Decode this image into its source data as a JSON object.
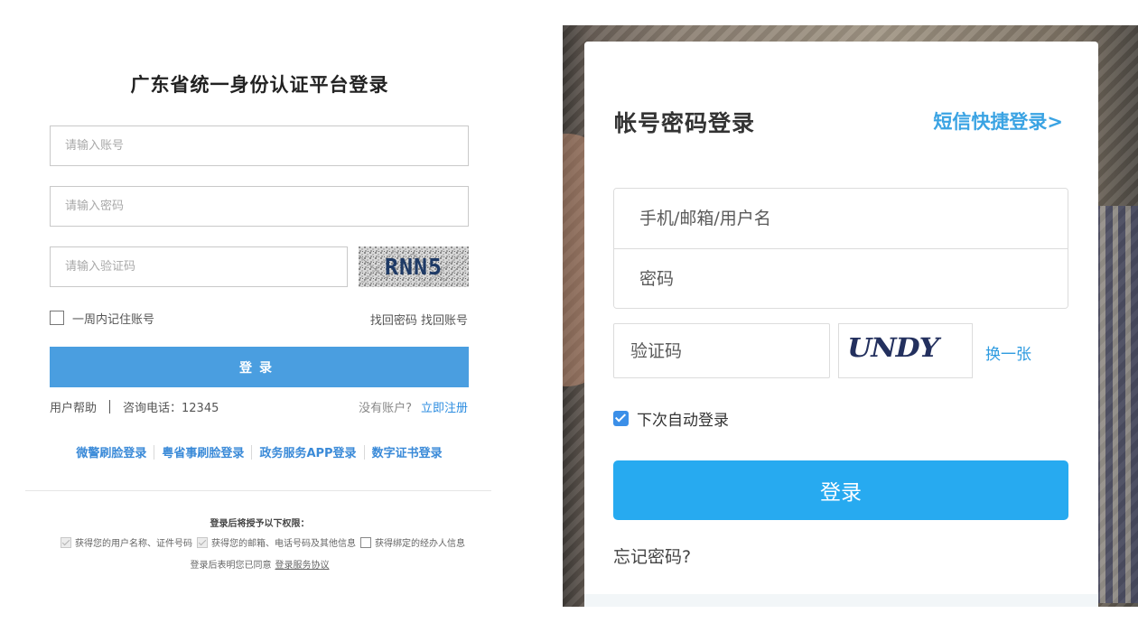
{
  "left_panel": {
    "title": "广东省统一身份认证平台登录",
    "account_placeholder": "请输入账号",
    "password_placeholder": "请输入密码",
    "captcha_placeholder": "请输入验证码",
    "captcha_text": "RNN5",
    "remember_label": "一周内记住账号",
    "find_password": "找回密码",
    "find_account": "找回账号",
    "login_button": "登录",
    "help": "用户帮助",
    "hotline": "咨询电话：12345",
    "no_account": "没有账户?",
    "register": "立即注册",
    "alt_logins": [
      "微警刷脸登录",
      "粤省事刷脸登录",
      "政务服务APP登录",
      "数字证书登录"
    ],
    "permission_title": "登录后将授予以下权限：",
    "permissions": [
      {
        "label": "获得您的用户名称、证件号码",
        "checked": true
      },
      {
        "label": "获得您的邮箱、电话号码及其他信息",
        "checked": true
      },
      {
        "label": "获得绑定的经办人信息",
        "checked": false
      }
    ],
    "agree_text": "登录后表明您已同意",
    "agree_link": "登录服务协议"
  },
  "right_panel": {
    "title": "帐号密码登录",
    "sms_login": "短信快捷登录>",
    "username_placeholder": "手机/邮箱/用户名",
    "password_placeholder": "密码",
    "code_placeholder": "验证码",
    "captcha_text": "UNDY",
    "change_captcha": "换一张",
    "auto_login": "下次自动登录",
    "auto_login_checked": true,
    "login_button": "登录",
    "forgot_password": "忘记密码?"
  },
  "colors": {
    "left_button": "#4a9ee0",
    "left_link": "#3a8ad8",
    "right_button": "#27aaf0",
    "right_link": "#3aa3e3",
    "checkbox": "#3b8fe8"
  }
}
